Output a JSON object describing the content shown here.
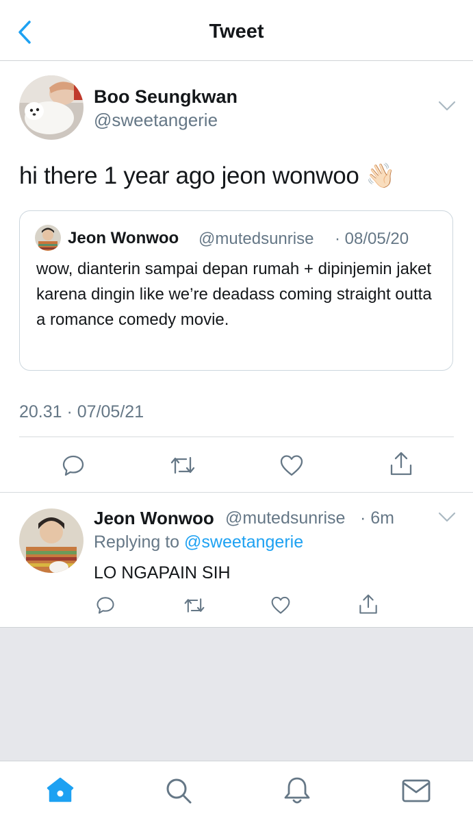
{
  "header": {
    "title": "Tweet"
  },
  "main_tweet": {
    "display_name": "Boo Seungkwan",
    "handle": "@sweetangerie",
    "text": "hi there 1 year ago jeon wonwoo 👋🏻",
    "timestamp": "20.31 · 07/05/21"
  },
  "quoted_tweet": {
    "display_name": "Jeon Wonwoo",
    "handle": "@mutedsunrise",
    "meta": "· 08/05/20",
    "text": "wow, dianterin sampai depan rumah + dipinjemin jaket karena dingin like we’re deadass coming straight outta a romance comedy movie."
  },
  "reply": {
    "display_name": "Jeon Wonwoo",
    "handle": "@mutedsunrise",
    "meta": "· 6m",
    "replying_prefix": "Replying to",
    "replying_handle": "@sweetangerie",
    "text": "LO NGAPAIN SIH"
  },
  "icons": {
    "back": "chevron-left-icon",
    "more": "chevron-down-icon",
    "reply": "speech-bubble-icon",
    "retweet": "retweet-icon",
    "like": "heart-icon",
    "share": "share-icon",
    "tabs": [
      "home-icon",
      "search-icon",
      "bell-icon",
      "mail-icon"
    ]
  },
  "colors": {
    "accent": "#1da1f2",
    "text": "#14171a",
    "muted": "#657786",
    "empty_area": "#e6e7eb"
  }
}
